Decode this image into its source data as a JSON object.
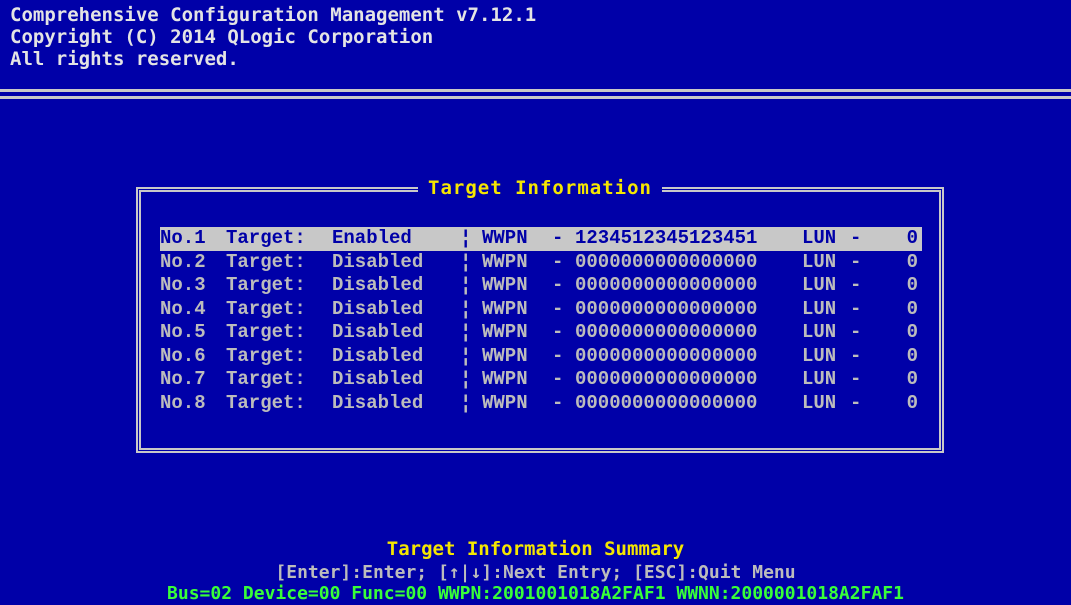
{
  "header": {
    "line1": "Comprehensive Configuration Management v7.12.1",
    "line2": "Copyright (C) 2014 QLogic Corporation",
    "line3": "All rights reserved."
  },
  "panel": {
    "title": "Target Information",
    "rows": [
      {
        "no": "No.1",
        "target": "Target:",
        "status": "Enabled",
        "sep": "¦",
        "wwpn_label": "WWPN",
        "dash": "-",
        "wwpn": "1234512345123451",
        "lun_label": "LUN",
        "lun_dash": "-",
        "lun": "0"
      },
      {
        "no": "No.2",
        "target": "Target:",
        "status": "Disabled",
        "sep": "¦",
        "wwpn_label": "WWPN",
        "dash": "-",
        "wwpn": "0000000000000000",
        "lun_label": "LUN",
        "lun_dash": "-",
        "lun": "0"
      },
      {
        "no": "No.3",
        "target": "Target:",
        "status": "Disabled",
        "sep": "¦",
        "wwpn_label": "WWPN",
        "dash": "-",
        "wwpn": "0000000000000000",
        "lun_label": "LUN",
        "lun_dash": "-",
        "lun": "0"
      },
      {
        "no": "No.4",
        "target": "Target:",
        "status": "Disabled",
        "sep": "¦",
        "wwpn_label": "WWPN",
        "dash": "-",
        "wwpn": "0000000000000000",
        "lun_label": "LUN",
        "lun_dash": "-",
        "lun": "0"
      },
      {
        "no": "No.5",
        "target": "Target:",
        "status": "Disabled",
        "sep": "¦",
        "wwpn_label": "WWPN",
        "dash": "-",
        "wwpn": "0000000000000000",
        "lun_label": "LUN",
        "lun_dash": "-",
        "lun": "0"
      },
      {
        "no": "No.6",
        "target": "Target:",
        "status": "Disabled",
        "sep": "¦",
        "wwpn_label": "WWPN",
        "dash": "-",
        "wwpn": "0000000000000000",
        "lun_label": "LUN",
        "lun_dash": "-",
        "lun": "0"
      },
      {
        "no": "No.7",
        "target": "Target:",
        "status": "Disabled",
        "sep": "¦",
        "wwpn_label": "WWPN",
        "dash": "-",
        "wwpn": "0000000000000000",
        "lun_label": "LUN",
        "lun_dash": "-",
        "lun": "0"
      },
      {
        "no": "No.8",
        "target": "Target:",
        "status": "Disabled",
        "sep": "¦",
        "wwpn_label": "WWPN",
        "dash": "-",
        "wwpn": "0000000000000000",
        "lun_label": "LUN",
        "lun_dash": "-",
        "lun": "0"
      }
    ]
  },
  "footer": {
    "title": "Target Information Summary",
    "keys": "[Enter]:Enter; [↑|↓]:Next Entry; [ESC]:Quit Menu",
    "bus_info": "Bus=02 Device=00 Func=00 WWPN:2001001018A2FAF1 WWNN:2000001018A2FAF1"
  },
  "colors": {
    "background": "#0000a8",
    "title_yellow": "#f5e600",
    "text_gray": "#bcbcbc",
    "highlight": "#c8c8c8",
    "status_green": "#38ff38"
  }
}
